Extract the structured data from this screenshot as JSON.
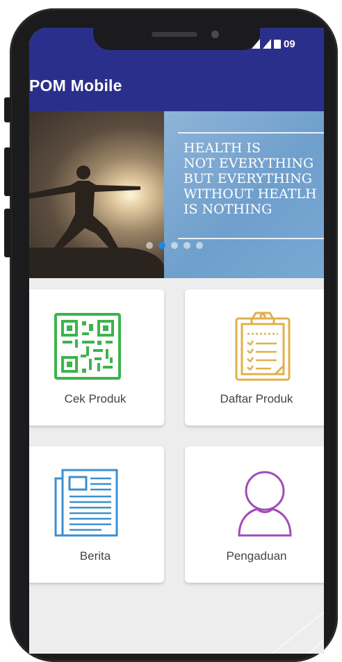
{
  "status_bar": {
    "time": "09"
  },
  "app_bar": {
    "title": "POM Mobile"
  },
  "banner": {
    "quote_lines": [
      "HEALTH IS",
      "NOT EVERYTHING",
      "BUT EVERYTHING",
      "WITHOUT HEATLH",
      "IS NOTHING"
    ],
    "slide_count": 5,
    "active_slide": 1
  },
  "menu": {
    "cek_produk": "Cek Produk",
    "daftar_produk": "Daftar Produk",
    "berita": "Berita",
    "pengaduan": "Pengaduan"
  },
  "colors": {
    "primary": "#2b2f8c",
    "qr_green": "#3cb44b",
    "clipboard_gold": "#e0b04a",
    "news_blue": "#3b8fd0",
    "person_purple": "#a24bb8",
    "dot_active": "#1e88e5"
  }
}
